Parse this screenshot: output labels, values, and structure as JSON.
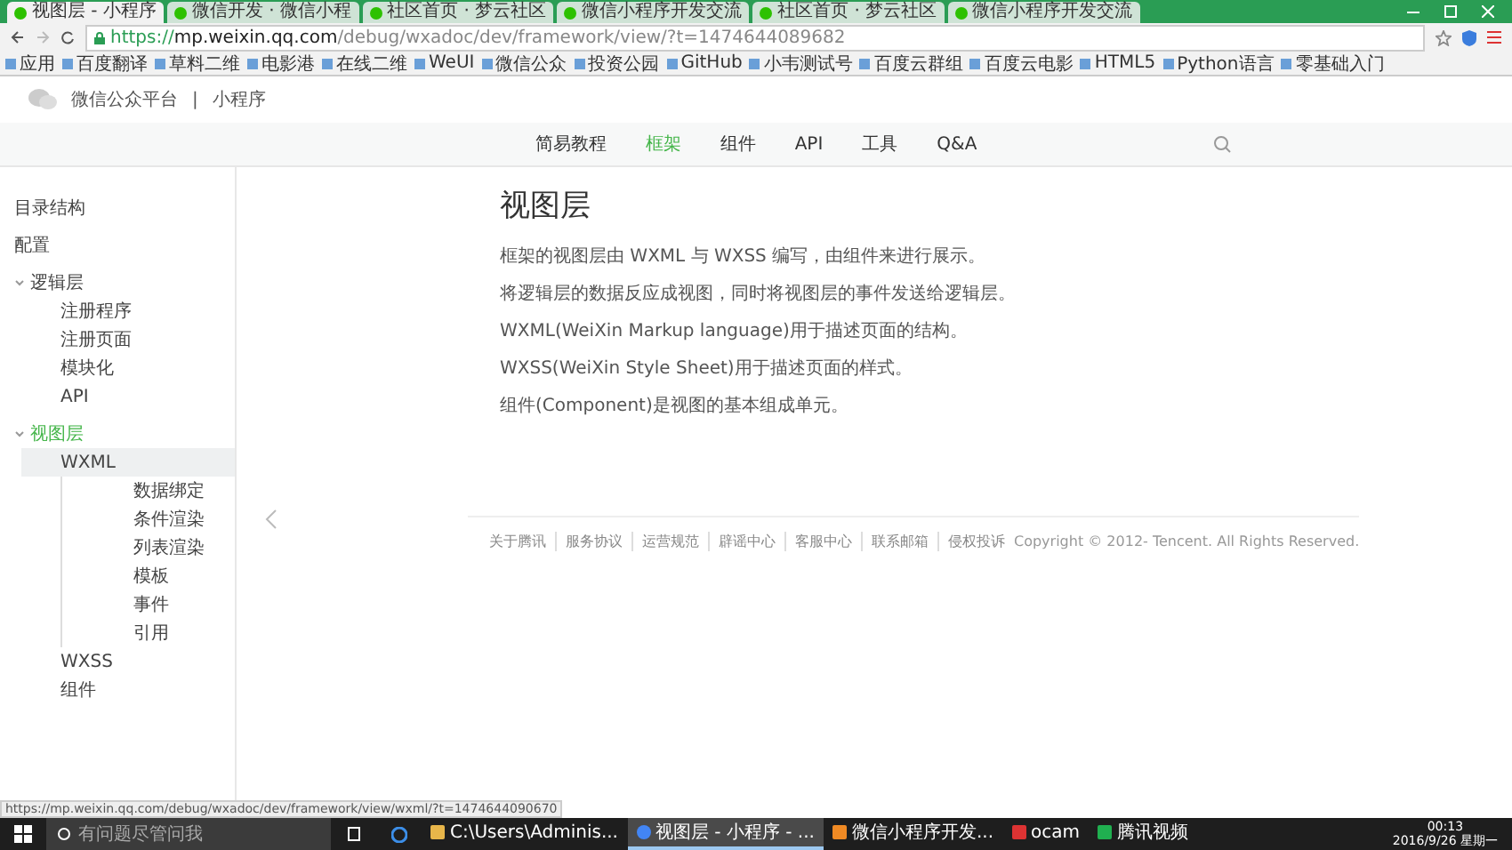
{
  "browser": {
    "tabs": [
      {
        "label": "视图层 - 小程序",
        "selected": true
      },
      {
        "label": "微信开发 · 微信小程",
        "selected": false
      },
      {
        "label": "社区首页 · 梦云社区",
        "selected": false
      },
      {
        "label": "微信小程序开发交流",
        "selected": false
      },
      {
        "label": "社区首页 · 梦云社区",
        "selected": false
      },
      {
        "label": "微信小程序开发交流",
        "selected": false
      }
    ],
    "url": {
      "scheme": "https://",
      "host": "mp.weixin.qq.com",
      "path": "/debug/wxadoc/dev/framework/view/?t=1474644089682"
    },
    "bookmarks": [
      "应用",
      "百度翻译",
      "草料二维",
      "电影港",
      "在线二维",
      "WeUI",
      "微信公众",
      "投资公园",
      "GitHub",
      "小韦测试号",
      "百度云群组",
      "百度云电影",
      "HTML5",
      "Python语言",
      "零基础入门"
    ],
    "status_url": "https://mp.weixin.qq.com/debug/wxadoc/dev/framework/view/wxml/?t=1474644090670"
  },
  "header": {
    "brand": "微信公众平台",
    "separator": "|",
    "product": "小程序"
  },
  "nav": [
    {
      "label": "简易教程",
      "selected": false
    },
    {
      "label": "框架",
      "selected": true
    },
    {
      "label": "组件",
      "selected": false
    },
    {
      "label": "API",
      "selected": false
    },
    {
      "label": "工具",
      "selected": false
    },
    {
      "label": "Q&A",
      "selected": false
    }
  ],
  "sidebar": {
    "items": [
      {
        "label": "目录结构",
        "selected": false
      },
      {
        "label": "配置",
        "selected": false
      },
      {
        "label": "逻辑层",
        "selected": false,
        "expanded": true,
        "children": [
          {
            "label": "注册程序",
            "selected": false
          },
          {
            "label": "注册页面",
            "selected": false
          },
          {
            "label": "模块化",
            "selected": false
          },
          {
            "label": "API",
            "selected": false
          }
        ]
      },
      {
        "label": "视图层",
        "selected": true,
        "expanded": true,
        "children": [
          {
            "label": "WXML",
            "selected": true,
            "children": [
              {
                "label": "数据绑定",
                "selected": false
              },
              {
                "label": "条件渲染",
                "selected": false
              },
              {
                "label": "列表渲染",
                "selected": false
              },
              {
                "label": "模板",
                "selected": false
              },
              {
                "label": "事件",
                "selected": false
              },
              {
                "label": "引用",
                "selected": false
              }
            ]
          },
          {
            "label": "WXSS",
            "selected": false
          },
          {
            "label": "组件",
            "selected": false
          }
        ]
      }
    ]
  },
  "content": {
    "title": "视图层",
    "paragraphs": [
      "框架的视图层由 WXML 与 WXSS 编写，由组件来进行展示。",
      "将逻辑层的数据反应成视图，同时将视图层的事件发送给逻辑层。",
      "WXML(WeiXin Markup language)用于描述页面的结构。",
      "WXSS(WeiXin Style Sheet)用于描述页面的样式。",
      "组件(Component)是视图的基本组成单元。"
    ]
  },
  "footer": {
    "links": [
      "关于腾讯",
      "服务协议",
      "运营规范",
      "辟谣中心",
      "客服中心",
      "联系邮箱",
      "侵权投诉"
    ],
    "copyright": "Copyright © 2012- Tencent. All Rights Reserved."
  },
  "taskbar": {
    "search_placeholder": "有问题尽管问我",
    "tasks": [
      {
        "label": "C:\\Users\\Adminis...",
        "kind": "folder",
        "selected": false
      },
      {
        "label": "视图层 - 小程序 - ...",
        "kind": "chrome",
        "selected": true
      },
      {
        "label": "微信小程序开发...",
        "kind": "devtool",
        "selected": false
      },
      {
        "label": "ocam",
        "kind": "ocam",
        "selected": false
      },
      {
        "label": "腾讯视频",
        "kind": "video",
        "selected": false
      }
    ],
    "time": "00:13",
    "date": "2016/9/26 星期一"
  }
}
